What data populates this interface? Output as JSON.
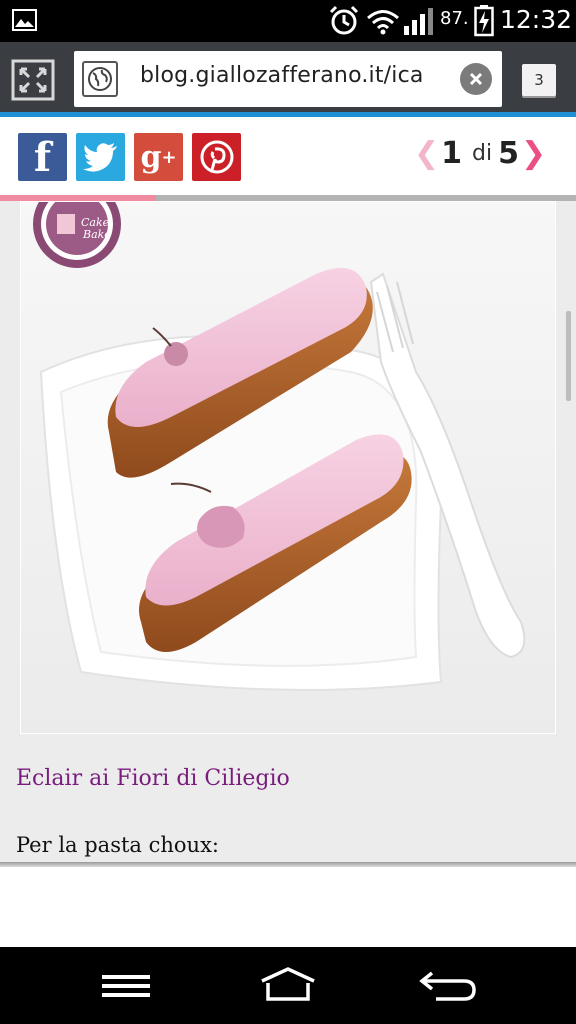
{
  "status_bar": {
    "battery_percent": "87.",
    "time": "12:32",
    "icons": [
      "gallery-icon",
      "alarm-icon",
      "wifi-icon",
      "signal-icon",
      "battery-icon"
    ]
  },
  "browser": {
    "url": "blog.giallozafferano.it/ica",
    "tab_count": "3",
    "icons": [
      "tabs-overview-icon",
      "globe-icon",
      "clear-icon"
    ]
  },
  "share_bar": {
    "social": [
      "facebook-icon",
      "twitter-icon",
      "google-plus-icon",
      "pinterest-icon"
    ],
    "pager": {
      "current": "1",
      "of_label": "di",
      "total": "5"
    },
    "progress_fraction": 0.27
  },
  "content": {
    "watermark_logo": "Cake Bake",
    "recipe_title": "Eclair ai Fiori di Ciliegio",
    "recipe_text": "Per la pasta choux:"
  },
  "colors": {
    "accent_pink": "#ea4f85",
    "title_purple": "#7a1c7e",
    "load_bar_blue": "#1e90d6",
    "toolbar": "#3a3d42"
  },
  "nav_bar": {
    "icons": [
      "menu-icon",
      "home-icon",
      "back-icon"
    ]
  }
}
